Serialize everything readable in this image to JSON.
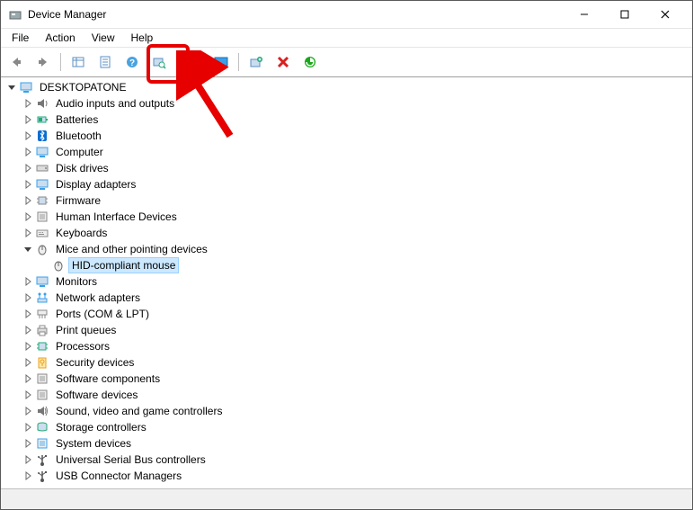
{
  "title": "Device Manager",
  "menu": [
    "File",
    "Action",
    "View",
    "Help"
  ],
  "toolbar": {
    "back": "Back",
    "forward": "Forward",
    "up": "Show hidden",
    "properties": "Properties",
    "help": "Help",
    "scan": "Scan for hardware changes",
    "update": "Update driver",
    "monitor": "Enable device",
    "add": "Add legacy hardware",
    "remove": "Uninstall device",
    "refresh": "Refresh"
  },
  "tree": {
    "root": "DESKTOPATONE",
    "nodes": [
      {
        "label": "Audio inputs and outputs",
        "icon": "audio"
      },
      {
        "label": "Batteries",
        "icon": "battery"
      },
      {
        "label": "Bluetooth",
        "icon": "bluetooth"
      },
      {
        "label": "Computer",
        "icon": "computer"
      },
      {
        "label": "Disk drives",
        "icon": "disk"
      },
      {
        "label": "Display adapters",
        "icon": "display"
      },
      {
        "label": "Firmware",
        "icon": "firmware"
      },
      {
        "label": "Human Interface Devices",
        "icon": "hid"
      },
      {
        "label": "Keyboards",
        "icon": "keyboard"
      },
      {
        "label": "Mice and other pointing devices",
        "icon": "mouse",
        "expanded": true,
        "children": [
          {
            "label": "HID-compliant mouse",
            "icon": "mouse-device",
            "selected": true
          }
        ]
      },
      {
        "label": "Monitors",
        "icon": "monitor"
      },
      {
        "label": "Network adapters",
        "icon": "network"
      },
      {
        "label": "Ports (COM & LPT)",
        "icon": "ports"
      },
      {
        "label": "Print queues",
        "icon": "printer"
      },
      {
        "label": "Processors",
        "icon": "cpu"
      },
      {
        "label": "Security devices",
        "icon": "security"
      },
      {
        "label": "Software components",
        "icon": "softcomp"
      },
      {
        "label": "Software devices",
        "icon": "softdev"
      },
      {
        "label": "Sound, video and game controllers",
        "icon": "sound"
      },
      {
        "label": "Storage controllers",
        "icon": "storage"
      },
      {
        "label": "System devices",
        "icon": "system"
      },
      {
        "label": "Universal Serial Bus controllers",
        "icon": "usb"
      },
      {
        "label": "USB Connector Managers",
        "icon": "usbconn"
      }
    ]
  }
}
